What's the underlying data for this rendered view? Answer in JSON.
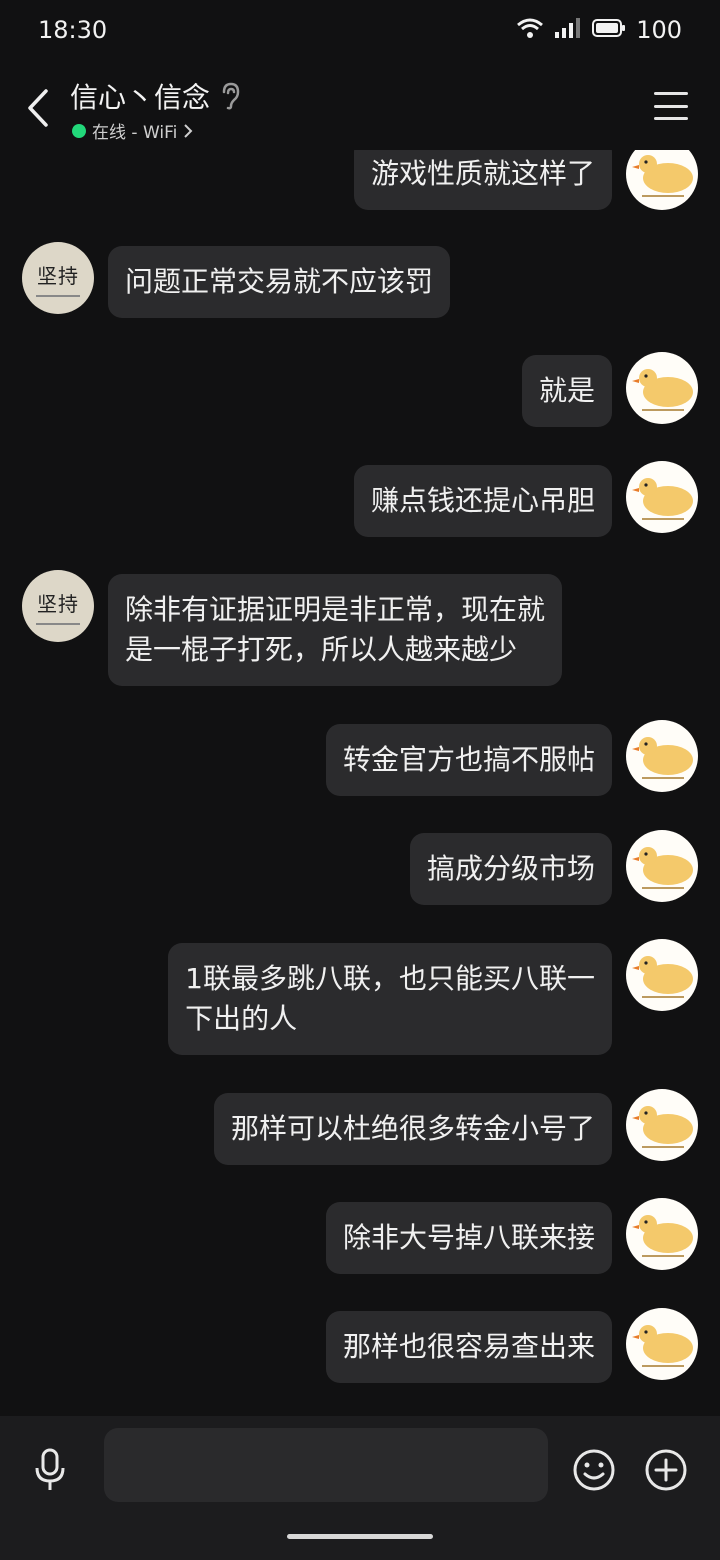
{
  "status_bar": {
    "time": "18:30",
    "battery": "100"
  },
  "header": {
    "title": "信心丶信念",
    "status_text": "在线 - WiFi",
    "status_color": "#22d87a"
  },
  "contacts": {
    "other_avatar_text": "坚持",
    "self_avatar_icon": "duck-sticker-icon"
  },
  "messages": [
    {
      "side": "right",
      "text": "游戏性质就这样了"
    },
    {
      "side": "left",
      "text": "问题正常交易就不应该罚"
    },
    {
      "side": "right",
      "text": "就是"
    },
    {
      "side": "right",
      "text": "赚点钱还提心吊胆"
    },
    {
      "side": "left",
      "text": "除非有证据证明是非正常，现在就\n是一棍子打死，所以人越来越少"
    },
    {
      "side": "right",
      "text": "转金官方也搞不服帖"
    },
    {
      "side": "right",
      "text": "搞成分级市场"
    },
    {
      "side": "right",
      "text": "1联最多跳八联，也只能买八联一\n下出的人"
    },
    {
      "side": "right",
      "text": "那样可以杜绝很多转金小号了"
    },
    {
      "side": "right",
      "text": "除非大号掉八联来接"
    },
    {
      "side": "right",
      "text": "那样也很容易查出来"
    }
  ],
  "composer": {
    "value": ""
  }
}
